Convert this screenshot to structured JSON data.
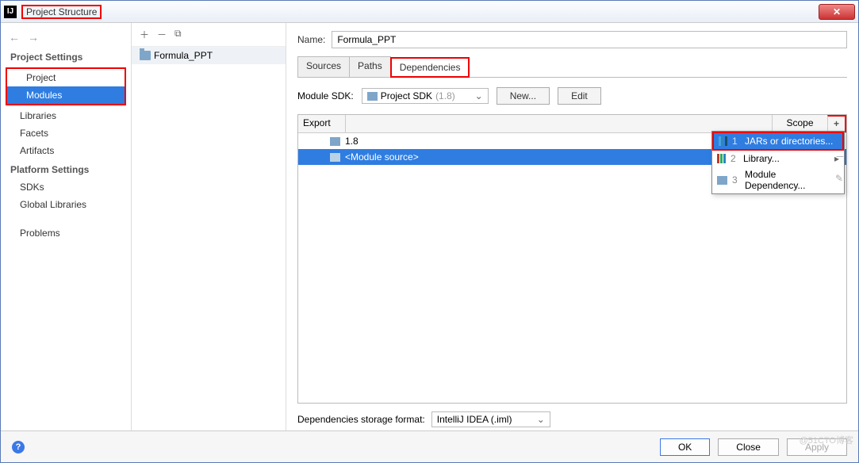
{
  "window": {
    "title": "Project Structure"
  },
  "sidebar": {
    "project_settings_label": "Project Settings",
    "items": [
      "Project",
      "Modules",
      "Libraries",
      "Facets",
      "Artifacts"
    ],
    "platform_settings_label": "Platform Settings",
    "platform_items": [
      "SDKs",
      "Global Libraries"
    ],
    "problems_label": "Problems"
  },
  "module_tree": {
    "module_name": "Formula_PPT"
  },
  "detail": {
    "name_label": "Name:",
    "name_value": "Formula_PPT",
    "tabs": {
      "sources": "Sources",
      "paths": "Paths",
      "dependencies": "Dependencies"
    },
    "sdk_label": "Module SDK:",
    "sdk_value": "Project SDK",
    "sdk_version": "(1.8)",
    "new_btn": "New...",
    "edit_btn": "Edit",
    "table": {
      "export_col": "Export",
      "scope_col": "Scope",
      "add_symbol": "+",
      "rows": [
        {
          "label": "1.8"
        },
        {
          "label": "<Module source>"
        }
      ]
    },
    "popup": {
      "jars": "JARs or directories...",
      "library": "Library...",
      "module_dep": "Module Dependency...",
      "n1": "1",
      "n2": "2",
      "n3": "3"
    },
    "storage_label": "Dependencies storage format:",
    "storage_value": "IntelliJ IDEA (.iml)"
  },
  "footer": {
    "ok": "OK",
    "close": "Close",
    "apply": "Apply"
  },
  "watermark": "@51CTO博客"
}
